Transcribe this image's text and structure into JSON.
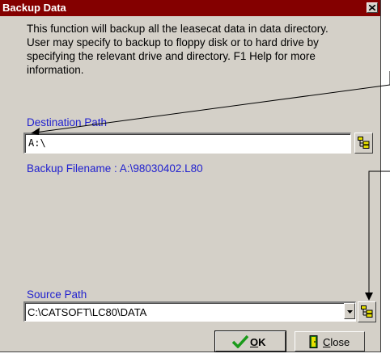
{
  "window": {
    "title": "Backup Data",
    "close_glyph": "x"
  },
  "description": [
    "This function will backup all the leasecat data in data directory.",
    "User may specify to backup to floppy disk or to hard drive by",
    "specifying the relevant drive and directory. F1 Help for more",
    "information."
  ],
  "destination": {
    "label": "Destination Path",
    "value": "A:\\"
  },
  "backup_filename": "Backup Filename : A:\\98030402.L80",
  "source": {
    "label": "Source Path",
    "value": "C:\\CATSOFT\\LC80\\DATA"
  },
  "buttons": {
    "ok_label": "OK",
    "close_label": "Close"
  },
  "colors": {
    "titlebar": "#840000",
    "label_blue": "#1f1fcf",
    "dialog_face": "#d4d0c8"
  }
}
